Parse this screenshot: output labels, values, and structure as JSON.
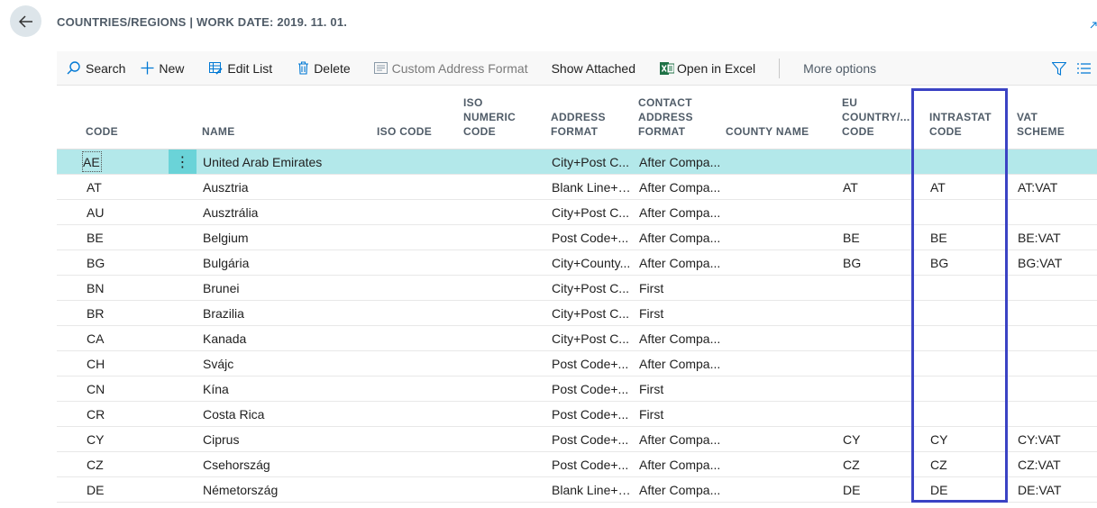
{
  "header": {
    "title": "COUNTRIES/REGIONS | WORK DATE: 2019. 11. 01."
  },
  "toolbar": {
    "search": "Search",
    "new": "New",
    "edit_list": "Edit List",
    "delete": "Delete",
    "custom_address_format": "Custom Address Format",
    "show_attached": "Show Attached",
    "open_in_excel": "Open in Excel",
    "more_options": "More options"
  },
  "columns": {
    "code": "CODE",
    "name": "NAME",
    "iso_code": "ISO CODE",
    "iso_numeric_code": [
      "ISO",
      "NUMERIC",
      "CODE"
    ],
    "address_format": [
      "ADDRESS",
      "FORMAT"
    ],
    "contact_address_format": [
      "CONTACT",
      "ADDRESS",
      "FORMAT"
    ],
    "county_name": "COUNTY NAME",
    "eu_country_code": [
      "EU",
      "COUNTRY/...",
      "CODE"
    ],
    "intrastat_code": [
      "INTRASTAT",
      "CODE"
    ],
    "vat_scheme": [
      "VAT",
      "SCHEME"
    ]
  },
  "rows": [
    {
      "code": "AE",
      "name": "United Arab Emirates",
      "iso": "",
      "isonum": "",
      "addr": "City+Post C...",
      "contact": "After Compa...",
      "county": "",
      "eu": "",
      "intrastat": "",
      "vat": ""
    },
    {
      "code": "AT",
      "name": "Ausztria",
      "iso": "",
      "isonum": "",
      "addr": "Blank Line+P...",
      "contact": "After Compa...",
      "county": "",
      "eu": "AT",
      "intrastat": "AT",
      "vat": "AT:VAT"
    },
    {
      "code": "AU",
      "name": "Ausztrália",
      "iso": "",
      "isonum": "",
      "addr": "City+Post C...",
      "contact": "After Compa...",
      "county": "",
      "eu": "",
      "intrastat": "",
      "vat": ""
    },
    {
      "code": "BE",
      "name": "Belgium",
      "iso": "",
      "isonum": "",
      "addr": "Post Code+...",
      "contact": "After Compa...",
      "county": "",
      "eu": "BE",
      "intrastat": "BE",
      "vat": "BE:VAT"
    },
    {
      "code": "BG",
      "name": "Bulgária",
      "iso": "",
      "isonum": "",
      "addr": "City+County...",
      "contact": "After Compa...",
      "county": "",
      "eu": "BG",
      "intrastat": "BG",
      "vat": "BG:VAT"
    },
    {
      "code": "BN",
      "name": "Brunei",
      "iso": "",
      "isonum": "",
      "addr": "City+Post C...",
      "contact": "First",
      "county": "",
      "eu": "",
      "intrastat": "",
      "vat": ""
    },
    {
      "code": "BR",
      "name": "Brazilia",
      "iso": "",
      "isonum": "",
      "addr": "City+Post C...",
      "contact": "First",
      "county": "",
      "eu": "",
      "intrastat": "",
      "vat": ""
    },
    {
      "code": "CA",
      "name": "Kanada",
      "iso": "",
      "isonum": "",
      "addr": "City+Post C...",
      "contact": "After Compa...",
      "county": "",
      "eu": "",
      "intrastat": "",
      "vat": ""
    },
    {
      "code": "CH",
      "name": "Svájc",
      "iso": "",
      "isonum": "",
      "addr": "Post Code+...",
      "contact": "After Compa...",
      "county": "",
      "eu": "",
      "intrastat": "",
      "vat": ""
    },
    {
      "code": "CN",
      "name": "Kína",
      "iso": "",
      "isonum": "",
      "addr": "Post Code+...",
      "contact": "First",
      "county": "",
      "eu": "",
      "intrastat": "",
      "vat": ""
    },
    {
      "code": "CR",
      "name": "Costa Rica",
      "iso": "",
      "isonum": "",
      "addr": "Post Code+...",
      "contact": "First",
      "county": "",
      "eu": "",
      "intrastat": "",
      "vat": ""
    },
    {
      "code": "CY",
      "name": "Ciprus",
      "iso": "",
      "isonum": "",
      "addr": "Post Code+...",
      "contact": "After Compa...",
      "county": "",
      "eu": "CY",
      "intrastat": "CY",
      "vat": "CY:VAT"
    },
    {
      "code": "CZ",
      "name": "Csehország",
      "iso": "",
      "isonum": "",
      "addr": "Post Code+...",
      "contact": "After Compa...",
      "county": "",
      "eu": "CZ",
      "intrastat": "CZ",
      "vat": "CZ:VAT"
    },
    {
      "code": "DE",
      "name": "Németország",
      "iso": "",
      "isonum": "",
      "addr": "Blank Line+P...",
      "contact": "After Compa...",
      "county": "",
      "eu": "DE",
      "intrastat": "DE",
      "vat": "DE:VAT"
    }
  ],
  "colors": {
    "selected_row": "#b3e8ea",
    "row_action": "#6ad3d8",
    "highlight": "#3b43c4",
    "excel_green": "#1e7145",
    "accent_blue": "#0078d4"
  }
}
